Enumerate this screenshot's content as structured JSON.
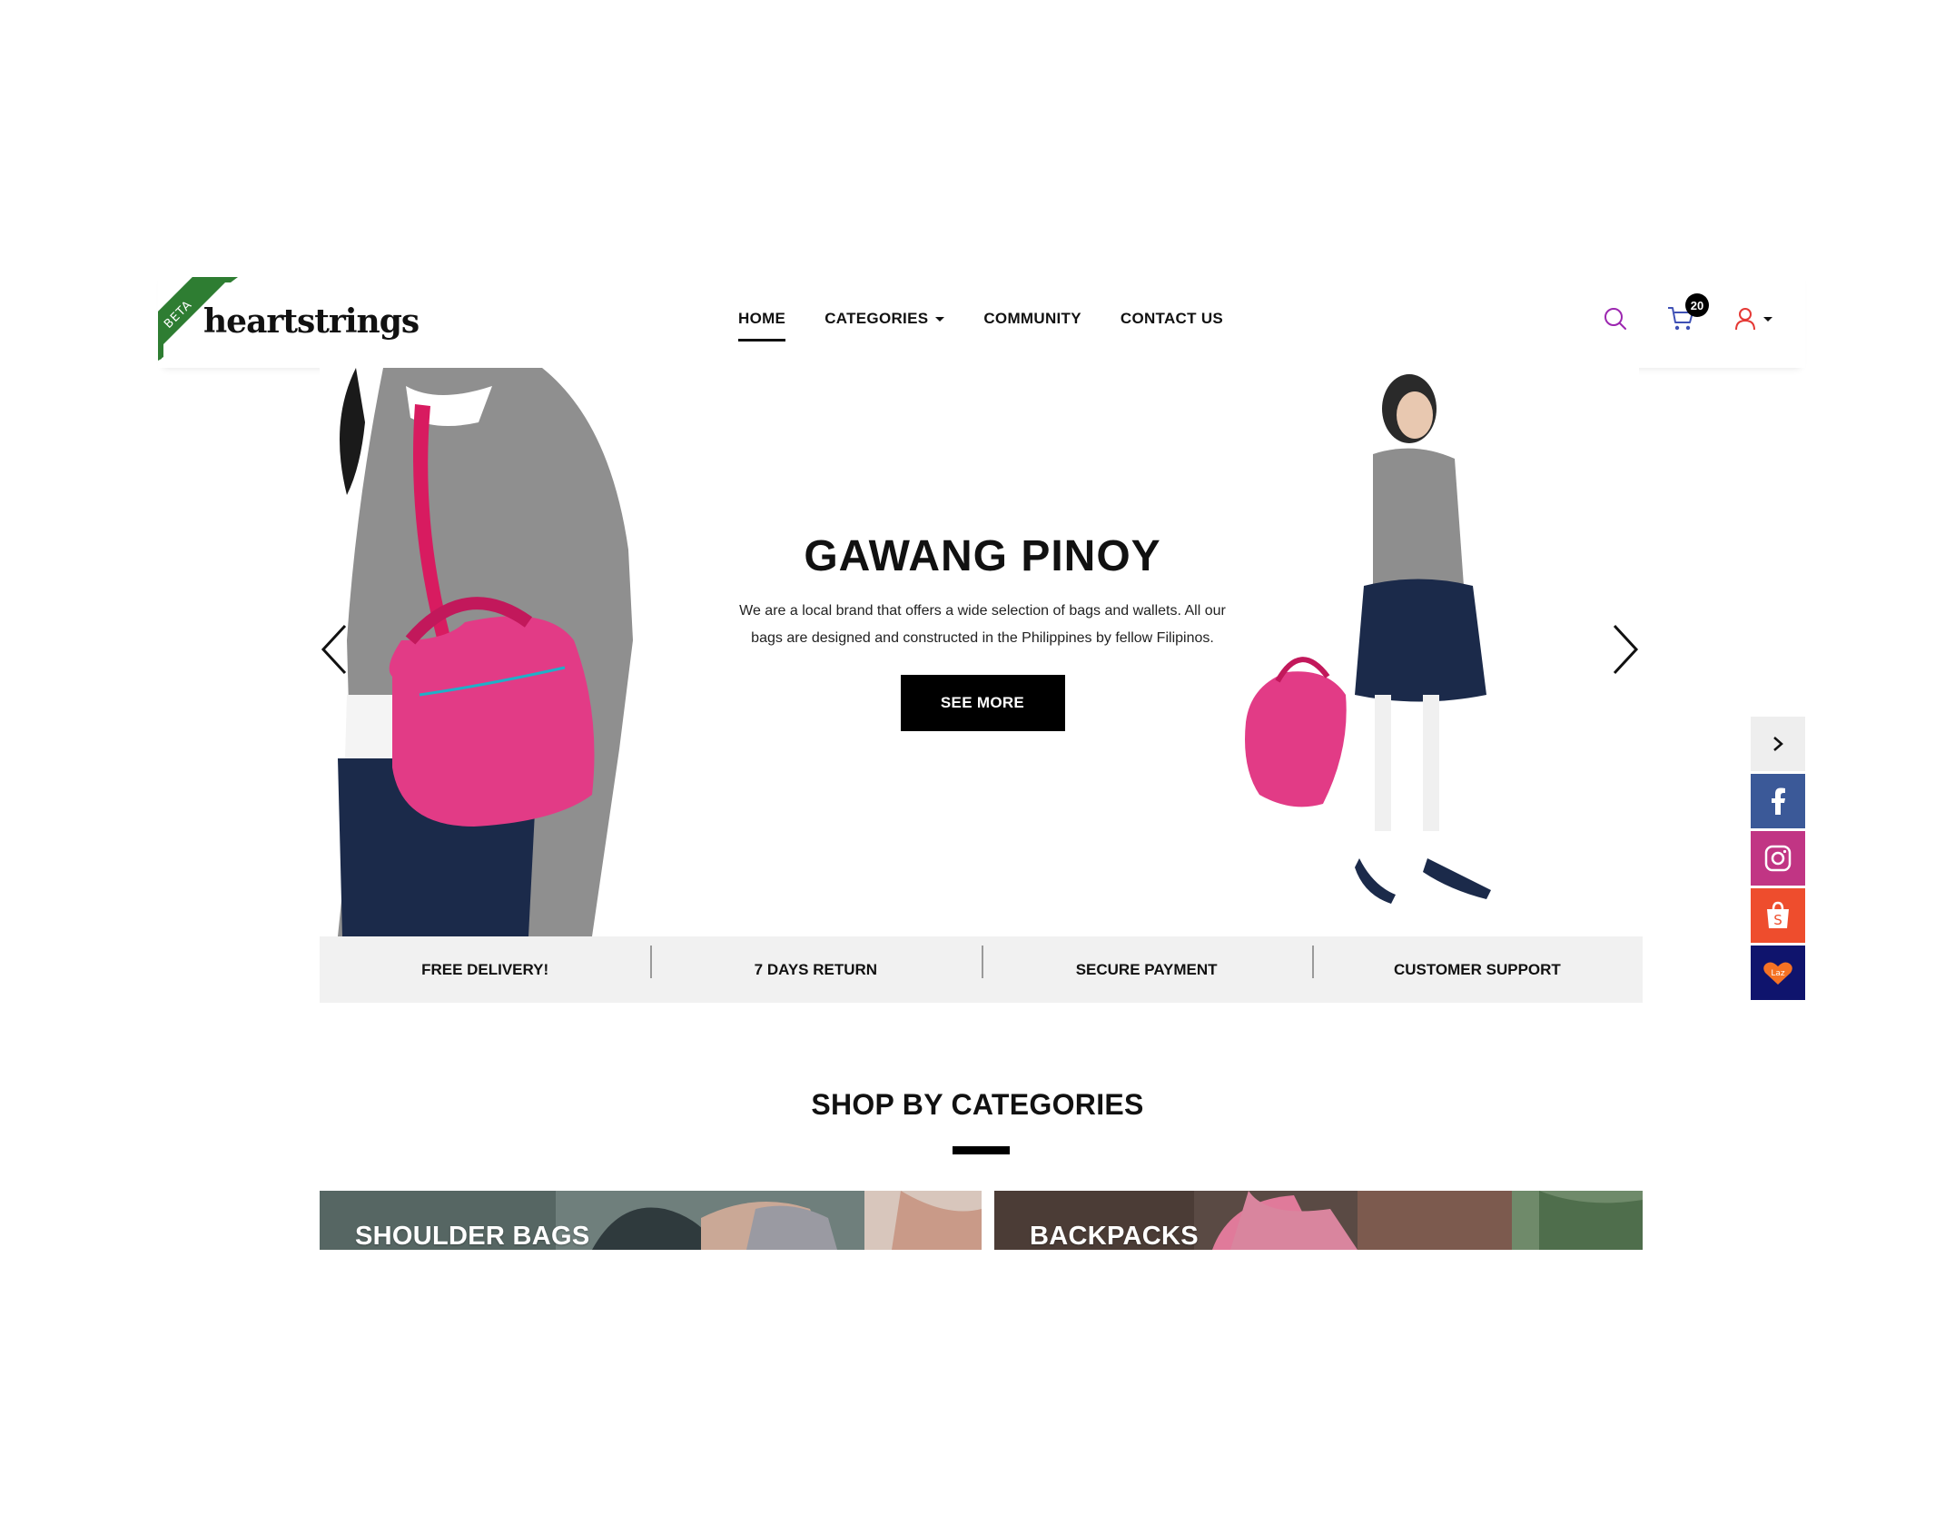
{
  "brand": {
    "name": "heartstrings",
    "badge": "BETA",
    "ribbon_color": "#2e7d32"
  },
  "nav": {
    "items": [
      {
        "label": "HOME",
        "active": true
      },
      {
        "label": "CATEGORIES",
        "dropdown": true
      },
      {
        "label": "COMMUNITY"
      },
      {
        "label": "CONTACT US"
      }
    ]
  },
  "header_actions": {
    "search_icon": "search-icon",
    "cart_icon": "cart-icon",
    "cart_count": "20",
    "user_icon": "user-icon",
    "search_color": "#9c27b0",
    "cart_color": "#3f51b5",
    "user_color": "#e53935"
  },
  "hero": {
    "title": "GAWANG PINOY",
    "description": "We are a local brand that offers a wide selection of bags and wallets. All our bags are designed and constructed in the Philippines by fellow Filipinos.",
    "button_label": "SEE MORE"
  },
  "features": [
    "FREE DELIVERY!",
    "7 DAYS RETURN",
    "SECURE PAYMENT",
    "CUSTOMER SUPPORT"
  ],
  "social_rail": [
    {
      "icon": "chevron-right-icon",
      "color": "#eeeeee"
    },
    {
      "icon": "facebook-icon",
      "color": "#3b5998"
    },
    {
      "icon": "instagram-icon",
      "color": "#c13584"
    },
    {
      "icon": "shopee-icon",
      "color": "#ee4d2d"
    },
    {
      "icon": "lazada-icon",
      "color": "#0f146d"
    }
  ],
  "categories": {
    "title": "SHOP BY CATEGORIES",
    "items": [
      {
        "label": "SHOULDER BAGS"
      },
      {
        "label": "BACKPACKS"
      }
    ]
  }
}
